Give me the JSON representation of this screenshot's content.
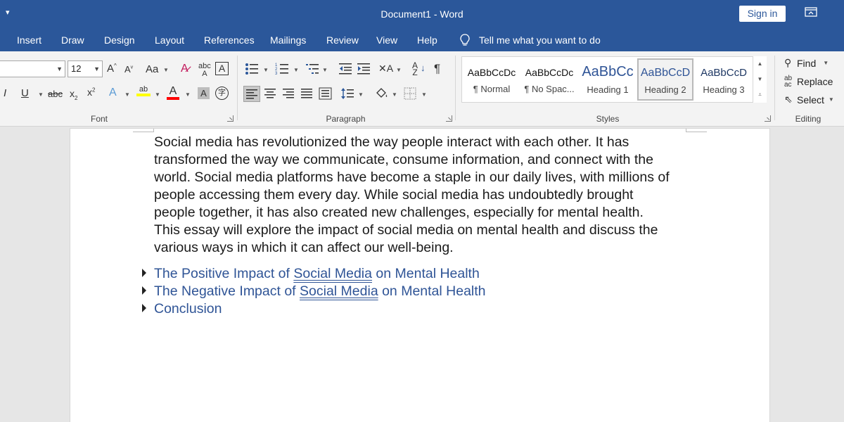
{
  "titlebar": {
    "qat_glyph": "▾",
    "title": "Document1  -  Word",
    "signin": "Sign in"
  },
  "tabs": [
    "Insert",
    "Draw",
    "Design",
    "Layout",
    "References",
    "Mailings",
    "Review",
    "View",
    "Help"
  ],
  "tell_me": "Tell me what you want to do",
  "font": {
    "size": "12",
    "group_label": "Font"
  },
  "paragraph": {
    "group_label": "Paragraph",
    "pilcrow": "¶"
  },
  "styles": {
    "group_label": "Styles",
    "items": [
      {
        "sample": "AaBbCcDc",
        "name": "¶ Normal"
      },
      {
        "sample": "AaBbCcDc",
        "name": "¶ No Spac..."
      },
      {
        "sample": "AaBbCc",
        "name": "Heading 1"
      },
      {
        "sample": "AaBbCcD",
        "name": "Heading 2"
      },
      {
        "sample": "AaBbCcD",
        "name": "Heading 3"
      }
    ]
  },
  "editing": {
    "group_label": "Editing",
    "find": "Find",
    "replace": "Replace",
    "select": "Select"
  },
  "document": {
    "lines": [
      "Social media has revolutionized the way people interact with each other. It has",
      "transformed the way we communicate, consume information, and connect with the",
      "world. Social media platforms have become a staple in our daily lives, with millions of",
      "people accessing them every day. While social media has undoubtedly brought",
      "people together, it has also created new challenges, especially for mental health.",
      "This essay will explore the impact of social media on mental health and discuss the",
      "various ways in which it can affect our well-being."
    ],
    "headings": [
      {
        "before": "The Positive Impact of ",
        "link": "Social Media",
        "after": " on Mental Health"
      },
      {
        "before": "The Negative Impact of ",
        "link": "Social Media",
        "after": " on Mental Health"
      },
      {
        "before": "Conclusion",
        "link": "",
        "after": ""
      }
    ]
  },
  "colors": {
    "accent": "#2b579a",
    "heading": "#2f5496",
    "highlight": "#ffff00",
    "font_color": "#ff0000"
  }
}
